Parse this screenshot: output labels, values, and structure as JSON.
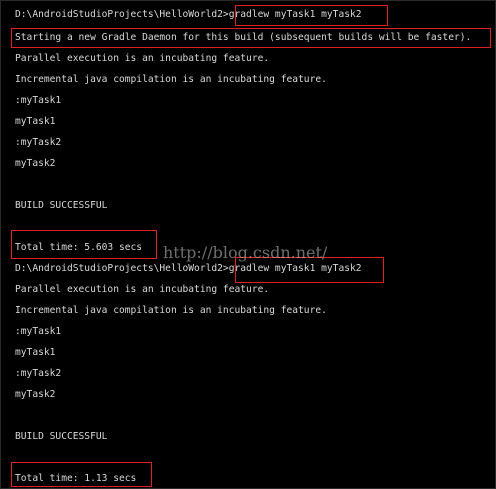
{
  "terminal": {
    "lines": [
      "D:\\AndroidStudioProjects\\HelloWorld2>gradlew myTask1 myTask2",
      "Starting a new Gradle Daemon for this build (subsequent builds will be faster).",
      "Parallel execution is an incubating feature.",
      "Incremental java compilation is an incubating feature.",
      ":myTask1",
      "myTask1",
      ":myTask2",
      "myTask2",
      "",
      "BUILD SUCCESSFUL",
      "",
      "Total time: 5.603 secs",
      "D:\\AndroidStudioProjects\\HelloWorld2>gradlew myTask1 myTask2",
      "Parallel execution is an incubating feature.",
      "Incremental java compilation is an incubating feature.",
      ":myTask1",
      "myTask1",
      ":myTask2",
      "myTask2",
      "",
      "BUILD SUCCESSFUL",
      "",
      "Total time: 1.13 secs"
    ]
  },
  "watermark": "http://blog.csdn.net/",
  "colors": {
    "background": "#000000",
    "text": "#d8d8d8",
    "highlight_box": "#e02020"
  }
}
